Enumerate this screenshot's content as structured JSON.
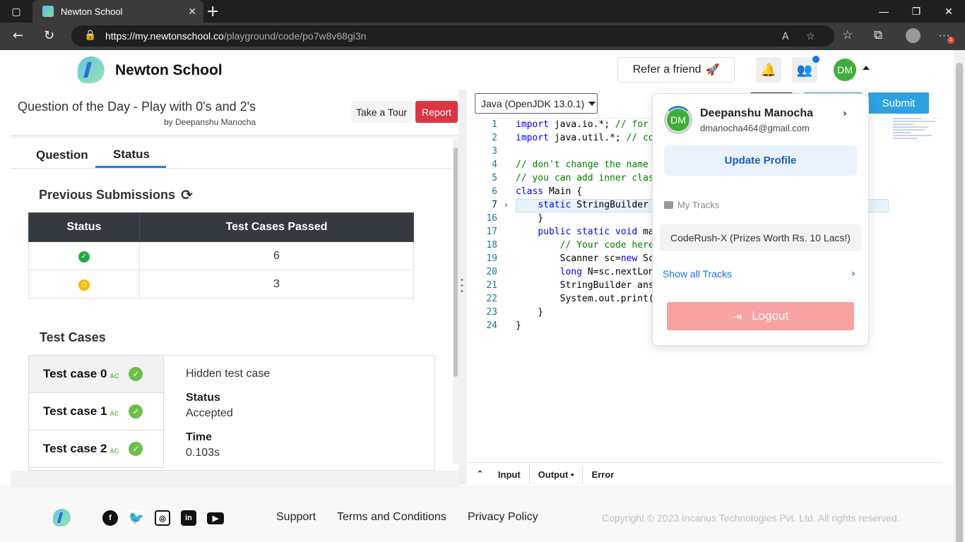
{
  "browser": {
    "tab_title": "Newton School",
    "url_host": "https://my.newtonschool.co",
    "url_path": "/playground/code/po7w8v68gi3n",
    "more_badge": "1"
  },
  "header": {
    "brand": "Newton School",
    "refer_label": "Refer a friend",
    "refer_emoji": "🚀",
    "avatar_initials": "DM"
  },
  "question": {
    "title": "Question of the Day - Play with 0's and 2's",
    "author": "by Deepanshu Manocha",
    "tour_label": "Take a Tour",
    "report_label": "Report"
  },
  "tabs": {
    "question": "Question",
    "status": "Status"
  },
  "submissions": {
    "heading": "Previous Submissions",
    "columns": [
      "Status",
      "Test Cases Passed"
    ],
    "rows": [
      {
        "status": "accepted",
        "passed": "6"
      },
      {
        "status": "pending",
        "passed": "3"
      }
    ]
  },
  "test_cases": {
    "heading": "Test Cases",
    "items": [
      {
        "label": "Test case 0",
        "tag": "AC"
      },
      {
        "label": "Test case 1",
        "tag": "AC"
      },
      {
        "label": "Test case 2",
        "tag": "AC"
      }
    ],
    "detail": {
      "title": "Hidden test case",
      "status_label": "Status",
      "status_value": "Accepted",
      "time_label": "Time",
      "time_value": "0.103s"
    }
  },
  "editor": {
    "language": "Java (OpenJDK 13.0.1)",
    "submit_label": "Submit",
    "line_numbers": [
      "1",
      "2",
      "3",
      "4",
      "5",
      "6",
      "7",
      "16",
      "17",
      "18",
      "19",
      "20",
      "21",
      "22",
      "23",
      "24"
    ]
  },
  "console_tabs": {
    "input": "Input",
    "output": "Output •",
    "error": "Error"
  },
  "profile_menu": {
    "name": "Deepanshu Manocha",
    "email": "dmanocha464@gmail.com",
    "update_label": "Update Profile",
    "tracks_label": "My Tracks",
    "track_item": "CodeRush-X (Prizes Worth Rs. 10 Lacs!)",
    "show_tracks": "Show all Tracks",
    "logout_label": "Logout"
  },
  "footer": {
    "links": [
      "Support",
      "Terms and Conditions",
      "Privacy Policy"
    ],
    "copyright": "Copyright © 2023 Incanus Technologies Pvt. Ltd. All rights reserved.",
    "social_icons": [
      "facebook-icon",
      "twitter-icon",
      "instagram-icon",
      "linkedin-icon",
      "youtube-icon"
    ]
  },
  "colors": {
    "accent_blue": "#2ca2e0",
    "report_red": "#dc3545",
    "success_green": "#28a745",
    "pending_yellow": "#f5b800",
    "logout_pink": "#f9a2a2"
  }
}
